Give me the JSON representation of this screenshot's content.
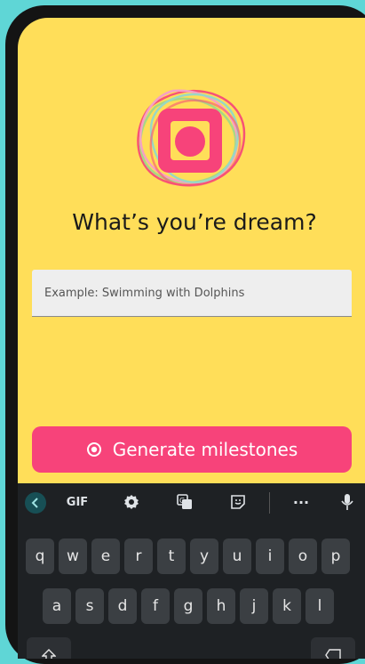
{
  "app": {
    "title": "What’s you’re dream?",
    "input_placeholder": "Example: Swimming with Dolphins",
    "input_value": "",
    "generate_label": "Generate milestones"
  },
  "colors": {
    "background": "#ffde59",
    "accent": "#f7437a",
    "outer": "#5fd6d6"
  },
  "keyboard": {
    "toolbar": [
      "back-icon",
      "GIF",
      "gear-icon",
      "translate-icon",
      "sticker-icon",
      "more-icon",
      "mic-icon"
    ],
    "gif_label": "GIF",
    "more_label": "···",
    "row1": [
      "q",
      "w",
      "e",
      "r",
      "t",
      "y",
      "u",
      "i",
      "o",
      "p"
    ],
    "row2": [
      "a",
      "s",
      "d",
      "f",
      "g",
      "h",
      "j",
      "k",
      "l"
    ]
  }
}
